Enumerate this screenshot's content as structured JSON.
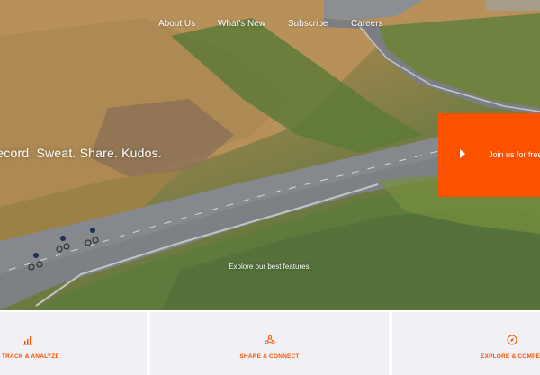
{
  "nav": {
    "about": "About Us",
    "news": "What's New",
    "subscribe": "Subscribe",
    "careers": "Careers"
  },
  "hero": {
    "headline": "Record. Sweat. Share. Kudos.",
    "cta_label": "Join us for free",
    "explore_text": "Explore our best features."
  },
  "features": [
    {
      "label": "TRACK & ANALYZE",
      "icon": "bar-chart-icon"
    },
    {
      "label": "SHARE & CONNECT",
      "icon": "people-connect-icon"
    },
    {
      "label": "EXPLORE & COMPETE",
      "icon": "compass-icon"
    }
  ],
  "colors": {
    "brand": "#fc5200",
    "card_background": "#f0f0f5",
    "nav_text": "#ffffff"
  }
}
